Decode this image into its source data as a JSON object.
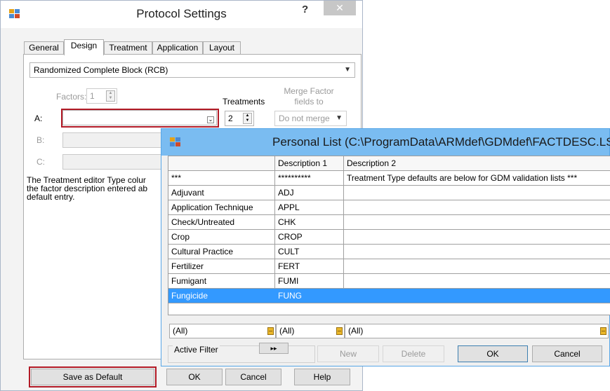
{
  "protocol_settings": {
    "title": "Protocol Settings",
    "help_glyph": "?",
    "close_glyph": "✕",
    "tabs": [
      "General",
      "Design",
      "Treatment",
      "Application",
      "Layout"
    ],
    "active_tab": "Design",
    "design_select": "Randomized Complete Block (RCB)",
    "factors_label": "Factors:",
    "factors_value": "1",
    "treatments_label": "Treatments",
    "treatments_value": "2",
    "merge_label_1": "Merge Factor",
    "merge_label_2": "fields to",
    "merge_select": "Do not merge",
    "row_a": "A:",
    "row_b": "B:",
    "row_c": "C:",
    "info_line1": "The Treatment editor Type colur",
    "info_line2": "the factor description entered ab",
    "info_line3": "default entry.",
    "save_default": "Save as Default",
    "ok": "OK",
    "cancel": "Cancel",
    "help": "Help"
  },
  "personal_list": {
    "title": "Personal List (C:\\ProgramData\\ARMdef\\GDMdef\\FACTDESC.LST",
    "headers": [
      "",
      "Description 1",
      "Description 2"
    ],
    "rows": [
      [
        "***",
        "**********",
        "Treatment Type defaults are below for GDM validation lists ***"
      ],
      [
        "Adjuvant",
        "ADJ",
        ""
      ],
      [
        "Application Technique",
        "APPL",
        ""
      ],
      [
        "Check/Untreated",
        "CHK",
        ""
      ],
      [
        "Crop",
        "CROP",
        ""
      ],
      [
        "Cultural Practice",
        "CULT",
        ""
      ],
      [
        "Fertilizer",
        "FERT",
        ""
      ],
      [
        "Fumigant",
        "FUMI",
        ""
      ],
      [
        "Fungicide",
        "FUNG",
        ""
      ]
    ],
    "selected_row": "Fungicide",
    "filters": [
      "(All)",
      "(All)",
      "(All)"
    ],
    "active_filter": "Active Filter",
    "filter_toggle": "▸▸",
    "new": "New",
    "delete": "Delete",
    "ok": "OK",
    "cancel": "Cancel"
  },
  "colors": {
    "selection": "#3399ff",
    "titlebar_active": "#7abcf1",
    "highlight_red": "#b21a26"
  }
}
